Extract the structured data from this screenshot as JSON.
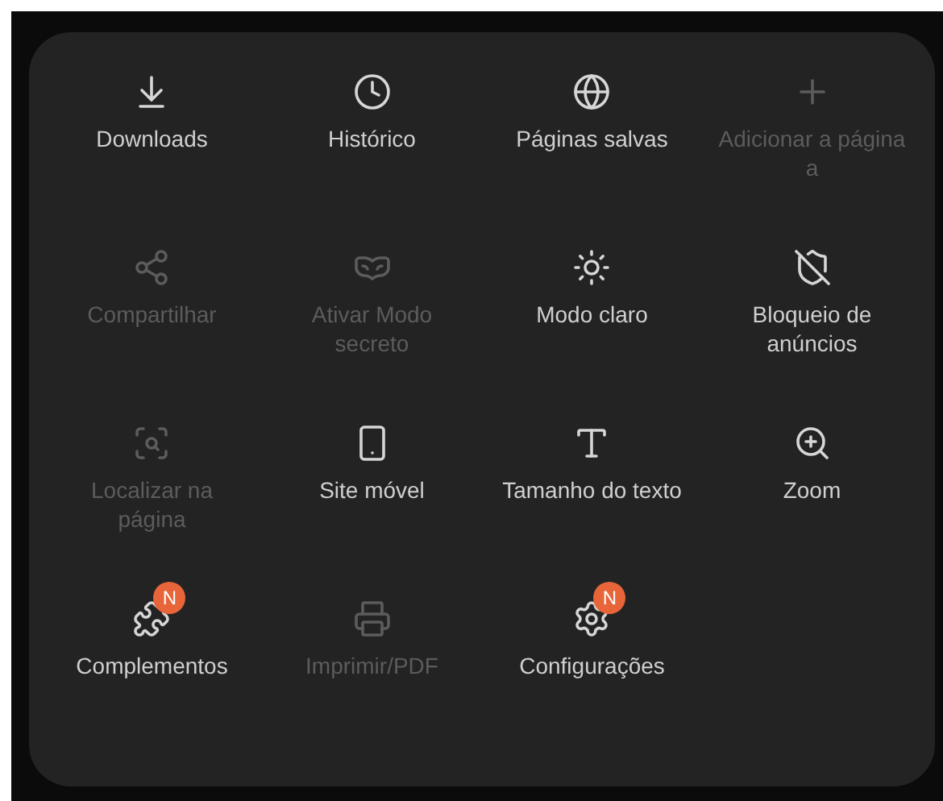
{
  "menu_items": [
    {
      "label": "Downloads",
      "disabled": false
    },
    {
      "label": "Histórico",
      "disabled": false
    },
    {
      "label": "Páginas salvas",
      "disabled": false
    },
    {
      "label": "Adicionar a página a",
      "disabled": true
    },
    {
      "label": "Compartilhar",
      "disabled": true
    },
    {
      "label": "Ativar Modo secreto",
      "disabled": true
    },
    {
      "label": "Modo claro",
      "disabled": false
    },
    {
      "label": "Bloqueio de anúncios",
      "disabled": false
    },
    {
      "label": "Localizar na página",
      "disabled": true
    },
    {
      "label": "Site móvel",
      "disabled": false
    },
    {
      "label": "Tamanho do texto",
      "disabled": false
    },
    {
      "label": "Zoom",
      "disabled": false
    },
    {
      "label": "Complementos",
      "disabled": false,
      "badge": "N"
    },
    {
      "label": "Imprimir/PDF",
      "disabled": true
    },
    {
      "label": "Configurações",
      "disabled": false,
      "badge": "N"
    }
  ]
}
